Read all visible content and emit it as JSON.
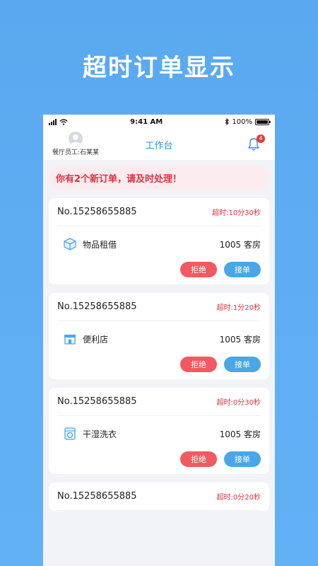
{
  "promo": {
    "title": "超时订单显示"
  },
  "statusbar": {
    "time": "9:41 AM",
    "battery": "100%"
  },
  "nav": {
    "user_label": "餐厅员工:石某某",
    "title": "工作台",
    "bell_count": "4"
  },
  "alert": {
    "text": "你有2个新订单，请及时处理！"
  },
  "orders": [
    {
      "no": "No.15258655885",
      "timeout": "超时:10分30秒",
      "service": "物品租借",
      "icon": "box-icon",
      "room": "1005 客房",
      "reject": "拒绝",
      "accept": "接单"
    },
    {
      "no": "No.15258655885",
      "timeout": "超时:1分20秒",
      "service": "便利店",
      "icon": "store-icon",
      "room": "1005 客房",
      "reject": "拒绝",
      "accept": "接单"
    },
    {
      "no": "No.15258655885",
      "timeout": "超时:0分30秒",
      "service": "干湿洗衣",
      "icon": "washer-icon",
      "room": "1005 客房",
      "reject": "拒绝",
      "accept": "接单"
    },
    {
      "no": "No.15258655885",
      "timeout": "超时:0分20秒"
    }
  ],
  "colors": {
    "accent": "#4aa6e6",
    "danger": "#f05a60",
    "background": "#5aa9f0"
  }
}
